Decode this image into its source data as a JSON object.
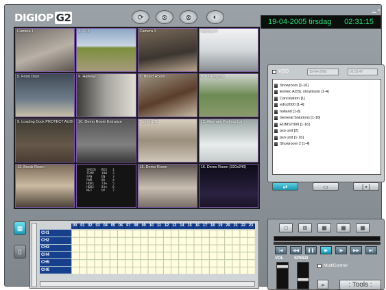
{
  "app": {
    "logo_text": "DIGIOP",
    "logo_suffix": "G2",
    "date": "19-04-2005 tirsdag",
    "time": "02:31:15"
  },
  "cameras": [
    {
      "label": "Camera 1"
    },
    {
      "label": "2. PTZ"
    },
    {
      "label": "Camera 3"
    },
    {
      "label": "Camera 4"
    },
    {
      "label": "5. Front Door"
    },
    {
      "label": "6. Hallway"
    },
    {
      "label": "7. Board Room"
    },
    {
      "label": "8. Parking Lot"
    },
    {
      "label": "9. Loading Dock PROTECT AUDI"
    },
    {
      "label": "10. Demo Room Entrance"
    },
    {
      "label": "Camera 11"
    },
    {
      "label": "12. Alternate Parking Lot"
    },
    {
      "label": "13. Break Room"
    },
    {
      "label": ""
    },
    {
      "label": "15. Demo Room"
    },
    {
      "label": "16. Demo Room (320x240)"
    }
  ],
  "diag_text": "SPEED   RES   1\nTEMP    100   2\nFAN     ON    3\nPWR     OK    4\nHDD1    73%   5\nHDD2    81%   6\nNET     UP    7",
  "vod": {
    "label": "VOD",
    "date": "19-04-2005",
    "time": "02:32:47"
  },
  "sites": [
    "Showroom [1-16]",
    "Emitec ADSL showroom [1-4]",
    "Cancelation [1]",
    "edrs2000 [1-4]",
    "holland [1-8]",
    "General Solutions [1-16]",
    "EDMS7000 [1-16]",
    "pso unit [2]",
    "pso unit [1-16]",
    "Showroom 2 [1-4]"
  ],
  "view_buttons": [
    "⇄",
    "▭",
    "[ ▪ ]"
  ],
  "schedule": {
    "hours": [
      "00",
      "01",
      "02",
      "03",
      "04",
      "05",
      "06",
      "07",
      "08",
      "09",
      "10",
      "11",
      "12",
      "13",
      "14",
      "15",
      "16",
      "17",
      "18",
      "19",
      "20",
      "21",
      "22",
      "23"
    ],
    "channels": [
      "CH1",
      "CH2",
      "CH3",
      "CH4",
      "CH5",
      "CH6"
    ]
  },
  "playback": {
    "buttons": [
      "|◀",
      "◀◀",
      "❚❚",
      "▶",
      "|▶",
      "▶▶",
      "▶|"
    ],
    "vol_label": "VOL",
    "speed_label": "SPEED",
    "multi_control": "MultiControl",
    "tools": ": Tools :",
    "vol_level": 0.9,
    "speed_level": 0.3
  },
  "colors": {
    "accent": "#1c95ad",
    "clock_green": "#29e07a",
    "schedule_header": "#163f8e"
  }
}
